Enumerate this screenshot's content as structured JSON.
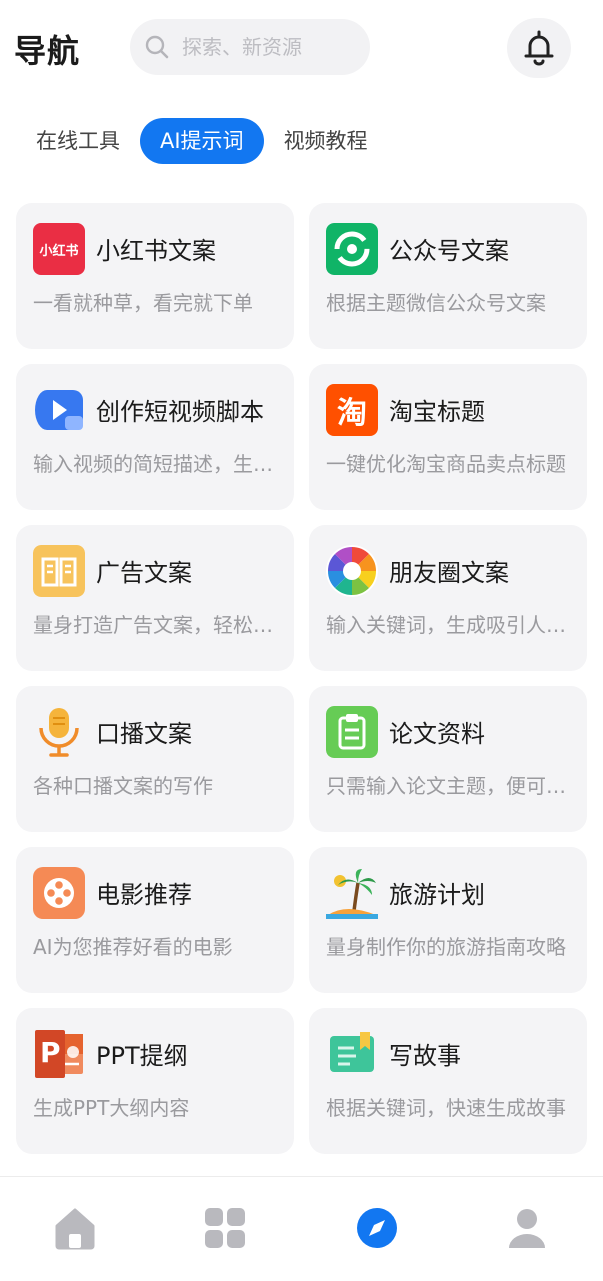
{
  "header": {
    "title": "导航",
    "search_placeholder": "探索、新资源"
  },
  "tabs": [
    {
      "label": "在线工具",
      "active": false
    },
    {
      "label": "AI提示词",
      "active": true
    },
    {
      "label": "视频教程",
      "active": false
    }
  ],
  "cards": [
    {
      "title": "小红书文案",
      "desc": "一看就种草，看完就下单",
      "icon": "xiaohongshu-icon",
      "icon_text": "小红书"
    },
    {
      "title": "公众号文案",
      "desc": "根据主题微信公众号文案",
      "icon": "wechat-official-icon"
    },
    {
      "title": "创作短视频脚本",
      "desc": "输入视频的简短描述，生成脚本",
      "icon": "short-video-icon"
    },
    {
      "title": "淘宝标题",
      "desc": "一键优化淘宝商品卖点标题",
      "icon": "taobao-icon",
      "icon_text": "淘"
    },
    {
      "title": "广告文案",
      "desc": "量身打造广告文案，轻松吸睛",
      "icon": "book-icon"
    },
    {
      "title": "朋友圈文案",
      "desc": "输入关键词，生成吸引人的文案",
      "icon": "moments-icon"
    },
    {
      "title": "口播文案",
      "desc": "各种口播文案的写作",
      "icon": "microphone-icon"
    },
    {
      "title": "论文资料",
      "desc": "只需输入论文主题，便可生成",
      "icon": "clipboard-icon"
    },
    {
      "title": "电影推荐",
      "desc": "AI为您推荐好看的电影",
      "icon": "film-reel-icon"
    },
    {
      "title": "旅游计划",
      "desc": "量身制作你的旅游指南攻略",
      "icon": "palm-tree-icon"
    },
    {
      "title": "PPT提纲",
      "desc": "生成PPT大纲内容",
      "icon": "powerpoint-icon",
      "icon_text": "P"
    },
    {
      "title": "写故事",
      "desc": "根据关键词，快速生成故事",
      "icon": "notebook-icon"
    }
  ],
  "bottom_nav": [
    {
      "name": "home",
      "icon": "home-icon",
      "active": false
    },
    {
      "name": "apps",
      "icon": "grid-icon",
      "active": false
    },
    {
      "name": "discover",
      "icon": "compass-icon",
      "active": true
    },
    {
      "name": "profile",
      "icon": "user-icon",
      "active": false
    }
  ],
  "colors": {
    "accent": "#1277f1",
    "card_bg": "#f4f4f6",
    "muted_icon": "#b9b9be"
  }
}
